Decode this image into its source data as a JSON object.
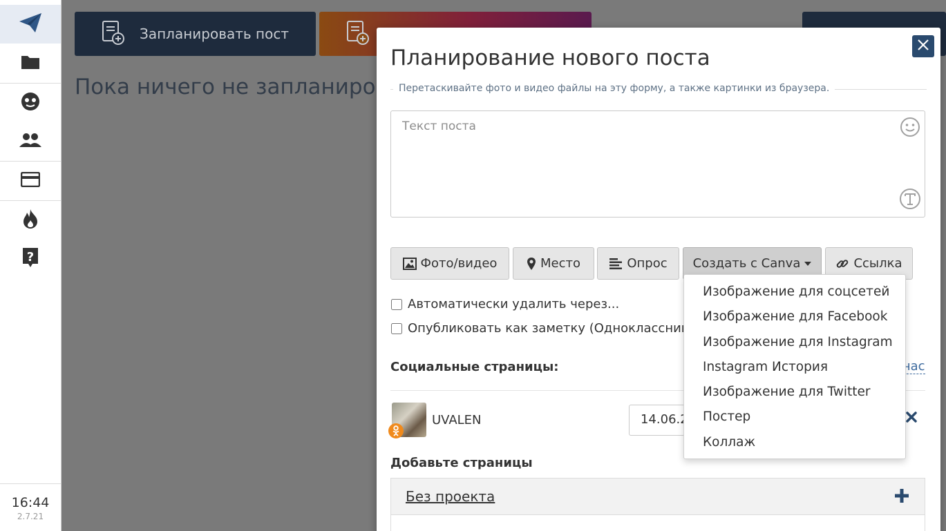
{
  "sidebar": {
    "time": "16:44",
    "version": "2.7.21"
  },
  "background": {
    "schedule_button": "Запланировать пост",
    "empty_message": "Пока ничего не запланиро"
  },
  "modal": {
    "title": "Планирование нового поста",
    "drop_hint": "Перетаскивайте фото и видео файлы на эту форму, а также картинки из браузера.",
    "post_text_placeholder": "Текст поста",
    "toolbar": {
      "photo_video": "Фото/видео",
      "place": "Место",
      "poll": "Опрос",
      "canva": "Создать с Canva",
      "link": "Ссылка"
    },
    "options": {
      "auto_delete": "Автоматически удалить через...",
      "publish_note": "Опубликовать как заметку (Одноклассники"
    },
    "social_pages_label": "Социальные страницы:",
    "now_link": "час",
    "page": {
      "name": "UVALEN",
      "date": "14.06.2"
    },
    "add_pages_label": "Добавьте страницы",
    "project": {
      "name": "Без проекта"
    }
  },
  "canva_menu": {
    "items": [
      "Изображение для соцсетей",
      "Изображение для Facebook",
      "Изображение для Instagram",
      "Instagram История",
      "Изображение для Twitter",
      "Постер",
      "Коллаж"
    ]
  },
  "colors": {
    "accent": "#2a4a6e",
    "overlay": "#7a7a7a",
    "link": "#3d6a9e",
    "ok_orange": "#f08a1c"
  }
}
